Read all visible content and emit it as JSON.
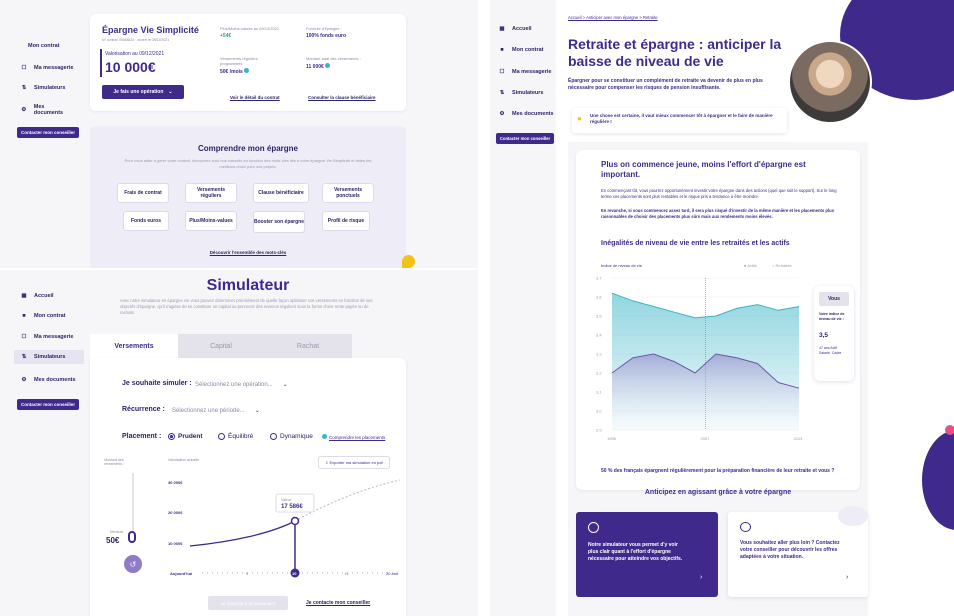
{
  "colors": {
    "primary": "#3f2a8c",
    "accent_yellow": "#f2c21a",
    "teal": "#38b4c8",
    "lilac": "#eeecf6",
    "pink": "#e8508a"
  },
  "panel_top": {
    "sidebar": {
      "items": [
        {
          "label": "Mon contrat",
          "icon": "doc-icon"
        },
        {
          "label": "Ma messagerie",
          "icon": "message-icon"
        },
        {
          "label": "Simulateurs",
          "icon": "sliders-icon"
        },
        {
          "label": "Mes documents",
          "icon": "folder-icon"
        }
      ],
      "cta": "Contacter mon conseiller"
    },
    "contract": {
      "title": "Épargne Vie Simplicité",
      "subtitle": "N° contrat 76548823 · ouvert le 09/12/2021",
      "valuation_label": "Valorisation au 09/12/2021",
      "valuation": "10 000€",
      "action_button": "Je fais une opération",
      "cells": [
        {
          "label": "Plus/Moins-values au 09/12/2021",
          "value": "+54€"
        },
        {
          "label": "Formule d'épargne :",
          "value": "100% fonds euro"
        },
        {
          "label": "Versements réguliers programmés :",
          "value": "50€ /mois"
        },
        {
          "label": "Montant total des versements :",
          "value": "11 000€"
        }
      ],
      "link_detail": "Voir le détail du contrat",
      "link_clause": "Consulter la clause bénéficiaire"
    },
    "understand": {
      "title": "Comprendre mon épargne",
      "text": "Pour vous aider à gérer votre contrat, découvrez tous nos conseils en fonction des mots-clés liés à votre épargne Vie Simplicité et faites les meilleurs choix pour vos projets.",
      "tags": [
        "Frais de contrat",
        "Versements réguliers",
        "Clause bénéficiaire",
        "Versements ponctuels",
        "Fonds euros",
        "Plus/Moins-values",
        "Booster son épargne",
        "Profil de risque"
      ],
      "link": "Découvrir l'ensemble des mots-clés"
    }
  },
  "panel_sim": {
    "sidebar": {
      "items": [
        {
          "label": "Accueil",
          "icon": "grid-icon"
        },
        {
          "label": "Mon contrat",
          "icon": "doc-icon"
        },
        {
          "label": "Ma messagerie",
          "icon": "message-icon"
        },
        {
          "label": "Simulateurs",
          "icon": "sliders-icon"
        },
        {
          "label": "Mes documents",
          "icon": "folder-icon"
        }
      ],
      "cta": "Contacter mon conseiller"
    },
    "title": "Simulateur",
    "intro": "Avec notre simulateur en épargne vie vous pouvez déterminer précisément de quelle façon optimiser vos versements en fonction de vos objectifs d'épargne, qu'il s'agisse de se constituer un capital ou percevoir des revenus réguliers sous la forme d'une rente payée ou de rachats.",
    "tabs": [
      "Versements",
      "Capital",
      "Rachat"
    ],
    "simulate_label": "Je souhaite simuler :",
    "simulate_placeholder": "Sélectionnez une opération...",
    "recurrence_label": "Récurrence :",
    "recurrence_placeholder": "Sélectionnez une période...",
    "placement_label": "Placement :",
    "placements": [
      "Prudent",
      "Équilibré",
      "Dynamique"
    ],
    "placement_link": "Comprendre les placements",
    "monthly_label": "Montant des versements :",
    "monthly_value_label": "Mensuel",
    "monthly_value": "50€",
    "export": "Exporter ma simulation en pdf",
    "current_value_label": "Valorisation actuelle",
    "chart_data": {
      "type": "line",
      "y_ticks": [
        "30 000€",
        "20 000€",
        "10 000€"
      ],
      "x_labels": [
        "Aujourd'hui",
        "5",
        "10",
        "15",
        "20 ans"
      ],
      "selected_x": "10",
      "tooltip_label": "Valeur",
      "tooltip_value": "17 586€"
    },
    "btn_disabled": "Je souscris à ce versement",
    "link_contact": "Je contacte mon conseiller"
  },
  "panel_right": {
    "sidebar": {
      "items": [
        {
          "label": "Accueil",
          "icon": "grid-icon"
        },
        {
          "label": "Mon contrat",
          "icon": "doc-icon"
        },
        {
          "label": "Ma messagerie",
          "icon": "message-icon"
        },
        {
          "label": "Simulateurs",
          "icon": "sliders-icon"
        },
        {
          "label": "Mes documents",
          "icon": "folder-icon"
        }
      ],
      "cta": "Contacter mon conseiller"
    },
    "breadcrumb": "Accueil > Anticiper avec mon épargne > Retraite",
    "title": "Retraite et épargne : anticiper la baisse de niveau de vie",
    "lead": "Épargner pour se constituer un complément de retraite va devenir de plus en plus nécessaire pour compenser les risques de pension insuffisante.",
    "tip": "Une chose est certaine, il vaut mieux commencer tôt à épargner et le faire de manière régulière !",
    "h2": "Plus on commence jeune, moins l'effort d'épargne est important.",
    "p1": "En commençant tôt, vous pourrez opportunément investir votre épargne dans des actions (quel que soit le support). Sur le long terme ces placements sont plus rentables et le risque pris a tendance à être moindre.",
    "p2": "En revanche, si vous commencez assez tard, il sera plus risqué d'investir de la même manière et les placements plus raisonnables de choisir des placements plus sûrs mais aux rendements moins élevés.",
    "chart_title": "Inégalités de niveau de vie entre les retraités et les actifs",
    "chart_data": {
      "type": "area",
      "ylabel": "Indice de niveau de vie",
      "legend": [
        "Actifs",
        "Retraités"
      ],
      "y_ticks": [
        "3,7",
        "3,6",
        "3,5",
        "3,4",
        "3,3",
        "3,2",
        "3,1",
        "3,0",
        "2,9"
      ],
      "x_ticks": [
        "1996",
        "2007",
        "2021"
      ],
      "ylim": [
        2.9,
        3.7
      ],
      "series": [
        {
          "name": "Actifs",
          "values": [
            3.62,
            3.58,
            3.55,
            3.52,
            3.49,
            3.5,
            3.54,
            3.56,
            3.53,
            3.55
          ]
        },
        {
          "name": "Retraités",
          "values": [
            3.2,
            3.28,
            3.3,
            3.26,
            3.2,
            3.3,
            3.28,
            3.25,
            3.15,
            3.12
          ]
        }
      ],
      "side_card": {
        "button": "Vous",
        "label": "Votre indice de niveau de vie :",
        "value": "3,5",
        "profile": "47 ans Actif Salarié, Cadre"
      }
    },
    "stat": "50 % des français épargnent régulièrement pour la préparation financière de leur retraite et vous ?",
    "anticipate": "Anticipez en agissant grâce à votre épargne",
    "card1": "Notre simulateur vous permet d'y voir plus clair quant à l'effort d'épargne nécessaire pour atteindre vos objectifs.",
    "card2": "Vous souhaitez aller plus loin ? Contactez votre conseiller pour découvrir les offres adaptées à votre situation."
  }
}
